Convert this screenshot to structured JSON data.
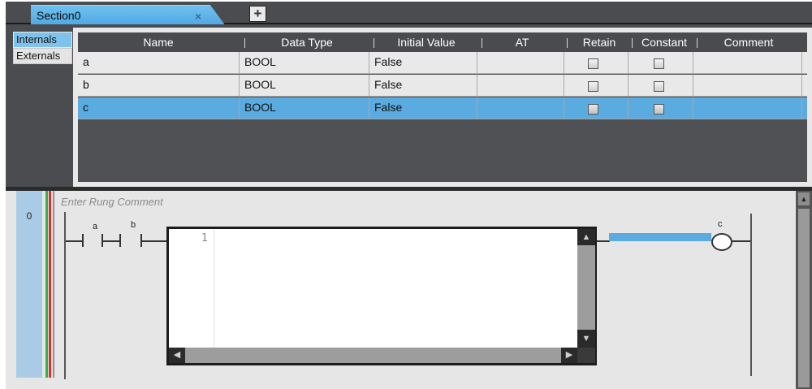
{
  "tabs": {
    "active_tab": "Section0",
    "close_glyph": "×",
    "add_glyph": "+"
  },
  "scopes": {
    "internals": "Internals",
    "externals": "Externals"
  },
  "table": {
    "columns": [
      "Name",
      "Data Type",
      "Initial Value",
      "AT",
      "Retain",
      "Constant",
      "Comment"
    ],
    "rows": [
      {
        "name": "a",
        "data_type": "BOOL",
        "initial_value": "False",
        "at": "",
        "retain": false,
        "constant": false,
        "comment": "",
        "selected": false
      },
      {
        "name": "b",
        "data_type": "BOOL",
        "initial_value": "False",
        "at": "",
        "retain": false,
        "constant": false,
        "comment": "",
        "selected": false
      },
      {
        "name": "c",
        "data_type": "BOOL",
        "initial_value": "False",
        "at": "",
        "retain": false,
        "constant": false,
        "comment": "",
        "selected": true
      }
    ]
  },
  "ladder": {
    "rung_number": "0",
    "rung_comment_placeholder": "Enter Rung Comment",
    "contact_a": "a",
    "contact_b": "b",
    "st_line_number": "1",
    "coil_c": "c"
  },
  "colors": {
    "selection": "#5aabdf",
    "tab_active": "#6fc0ef",
    "power_rail_green": "#2db34a",
    "power_rail_red": "#e02a2a"
  }
}
